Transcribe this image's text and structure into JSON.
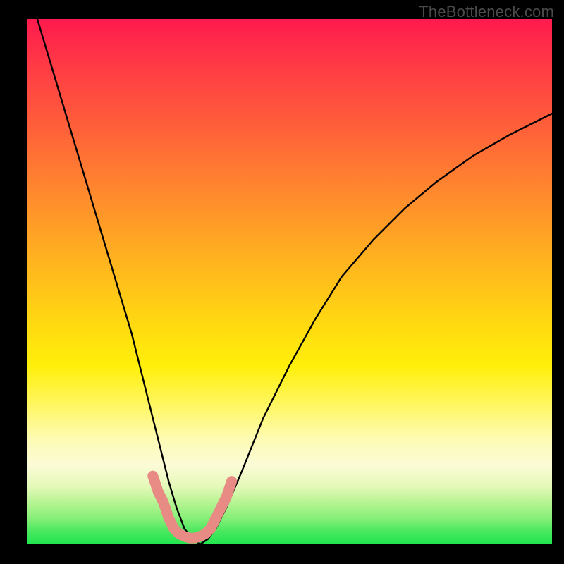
{
  "watermark": "TheBottleneck.com",
  "chart_data": {
    "type": "line",
    "title": "",
    "xlabel": "",
    "ylabel": "",
    "xlim": [
      0,
      100
    ],
    "ylim": [
      0,
      100
    ],
    "series": [
      {
        "name": "bottleneck-curve",
        "x": [
          2,
          5,
          8,
          11,
          14,
          17,
          20,
          22,
          24,
          25.5,
          27,
          28.5,
          30,
          31.5,
          33,
          34.5,
          36,
          38,
          41,
          45,
          50,
          55,
          60,
          66,
          72,
          78,
          85,
          92,
          100
        ],
        "values": [
          100,
          90,
          80,
          70,
          60,
          50,
          40,
          32,
          24,
          18,
          12,
          7,
          3,
          1,
          0,
          1,
          3,
          7,
          14,
          24,
          34,
          43,
          51,
          58,
          64,
          69,
          74,
          78,
          82
        ]
      },
      {
        "name": "highlight-band",
        "x": [
          24,
          25,
          26,
          27,
          28,
          29,
          30,
          31,
          32,
          33,
          34,
          35,
          36,
          37,
          38,
          39
        ],
        "values": [
          13,
          10,
          8,
          5,
          3,
          2,
          1.5,
          1.2,
          1.2,
          1.5,
          2,
          3,
          5,
          7,
          9,
          12
        ]
      }
    ],
    "colors": {
      "curve": "#000000",
      "highlight": "#e98b85",
      "gradient_top": "#ff1a4e",
      "gradient_mid": "#ffef0a",
      "gradient_bottom": "#1fe54f",
      "frame": "#000000"
    }
  }
}
